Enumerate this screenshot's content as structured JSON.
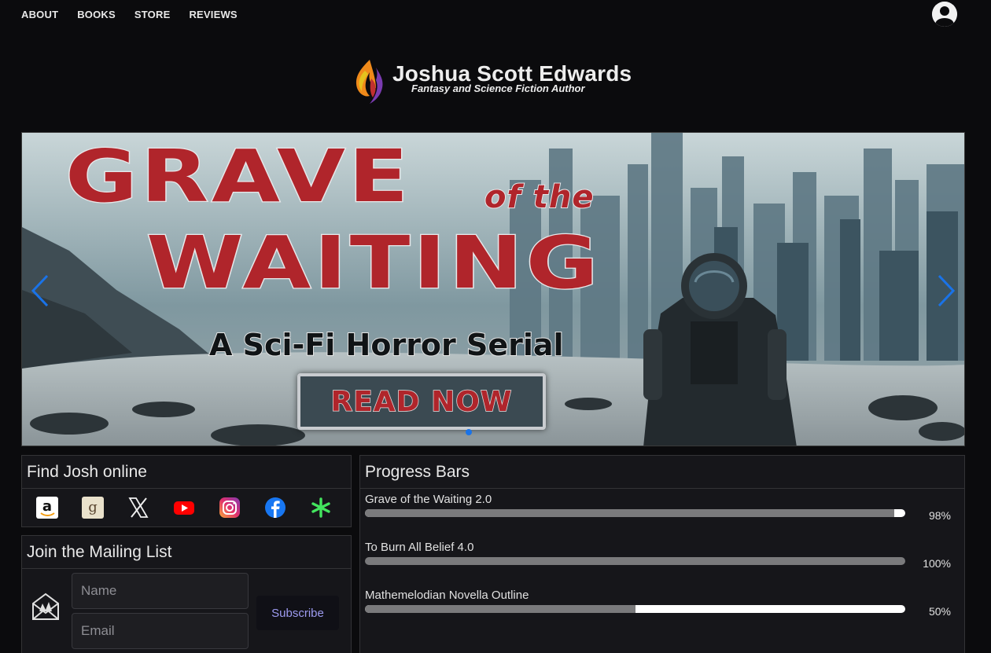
{
  "nav": {
    "links": [
      "ABOUT",
      "BOOKS",
      "STORE",
      "REVIEWS"
    ],
    "user_icon": "user-account-icon"
  },
  "logo": {
    "name": "Joshua Scott Edwards",
    "tagline": "Fantasy and Science Fiction Author"
  },
  "banner": {
    "title_line1": "GRAVE",
    "title_connector": "of the",
    "title_line2": "WAITING",
    "subtitle": "A Sci-Fi Horror Serial",
    "cta": "READ NOW",
    "prev_icon": "chevron-left-icon",
    "next_icon": "chevron-right-icon",
    "slide_count": 1,
    "active_slide": 1,
    "accent": "#1a73e8"
  },
  "find_online": {
    "title": "Find Josh online",
    "icons": [
      "amazon-icon",
      "goodreads-icon",
      "x-icon",
      "youtube-icon",
      "instagram-icon",
      "facebook-icon",
      "linktree-icon"
    ]
  },
  "mailing_list": {
    "title": "Join the Mailing List",
    "name_placeholder": "Name",
    "email_placeholder": "Email",
    "subscribe_label": "Subscribe",
    "icon": "mail-envelope-icon"
  },
  "progress": {
    "title": "Progress Bars",
    "items": [
      {
        "name": "Grave of the Waiting 2.0",
        "percent_label": "98%",
        "fraction": 0.98
      },
      {
        "name": "To Burn All Belief 4.0",
        "percent_label": "100%",
        "fraction": 1.0
      },
      {
        "name": "Mathemelodian Novella Outline",
        "percent_label": "50%",
        "fraction": 0.5
      }
    ]
  }
}
